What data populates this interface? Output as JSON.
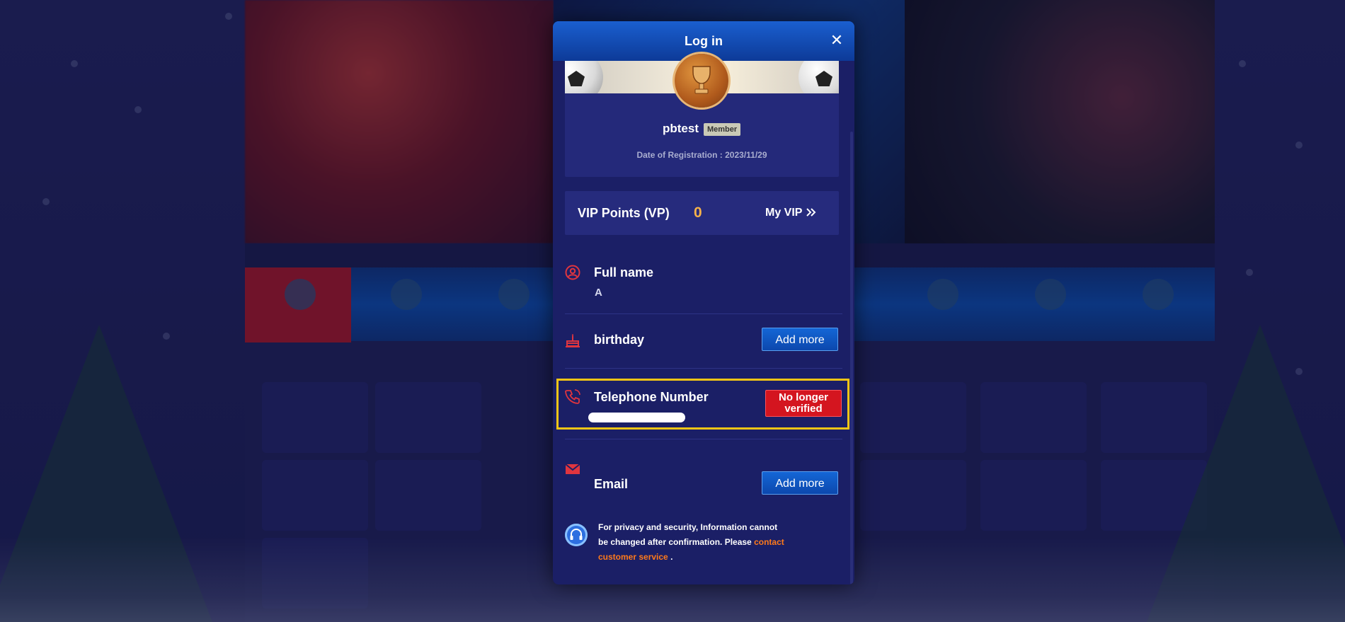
{
  "modal": {
    "title": "Log in",
    "close_label": "✕"
  },
  "profile": {
    "username": "pbtest",
    "level_badge": "Member",
    "registration": "Date of Registration : 2023/11/29"
  },
  "vip": {
    "label": "VIP Points (VP)",
    "points": "0",
    "link_label": "My VIP",
    "link_icon": "double-chevron-right-icon"
  },
  "fields": {
    "full_name": {
      "label": "Full name",
      "value": "A",
      "icon": "user-circle-icon"
    },
    "birthday": {
      "label": "birthday",
      "button": "Add more",
      "icon": "cake-icon"
    },
    "telephone": {
      "label": "Telephone Number",
      "status_button": "No longer verified",
      "icon": "phone-icon"
    },
    "email": {
      "label": "Email",
      "button": "Add more",
      "icon": "envelope-icon"
    }
  },
  "notice": {
    "text": "For privacy and security, Information cannot be changed after confirmation. Please",
    "link": "contact customer service",
    "end": ".",
    "icon": "headset-icon"
  },
  "colors": {
    "accent_orange": "#ff7a1a",
    "vip_gold": "#f5b14a",
    "alert_red": "#d4151f",
    "highlight_yellow": "#f3c516",
    "button_blue": "#1466d6"
  }
}
